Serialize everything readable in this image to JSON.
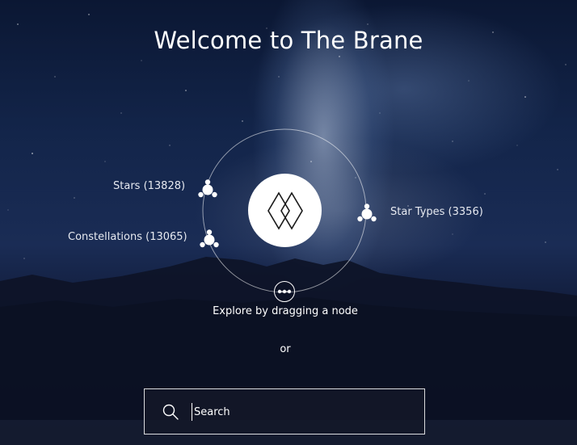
{
  "header": {
    "title": "Welcome to The Brane"
  },
  "graph": {
    "center_icon": "brane-logo-icon",
    "nodes": [
      {
        "label": "Stars (13828)",
        "icon": "node-cluster-icon"
      },
      {
        "label": "Constellations (13065)",
        "icon": "node-cluster-icon"
      },
      {
        "label": "Star Types (3356)",
        "icon": "node-cluster-icon"
      }
    ],
    "drag_icon": "drag-node-icon",
    "hint": "Explore by dragging a node",
    "separator": "or"
  },
  "search": {
    "placeholder": "Search",
    "value": "",
    "icon": "search-icon"
  },
  "colors": {
    "text": "#ffffff",
    "panel": "#141828"
  }
}
